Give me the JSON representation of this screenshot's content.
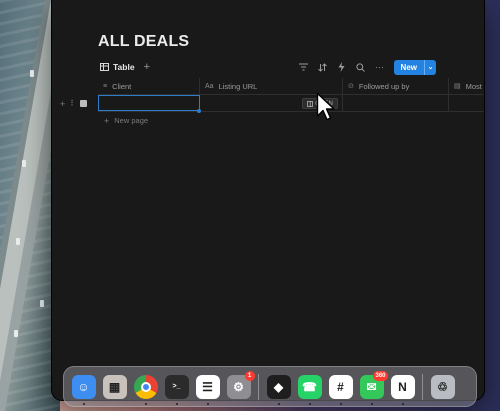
{
  "page": {
    "title": "ALL DEALS"
  },
  "toolbar": {
    "view_tab": "Table",
    "add_view": "+",
    "more": "···",
    "new_label": "New",
    "new_caret": "⌄",
    "accent_color": "#2383e2",
    "tool_icons": [
      "filter-icon",
      "sort-icon",
      "automation-bolt-icon",
      "search-icon",
      "more-icon"
    ]
  },
  "table": {
    "columns": [
      {
        "icon": "≡",
        "label": "Client",
        "icon_name": "text-lines-icon"
      },
      {
        "icon": "Aa",
        "label": "Listing URL",
        "icon_name": "title-aa-icon"
      },
      {
        "icon": "⊙",
        "label": "Followed up by",
        "icon_name": "status-circle-icon"
      },
      {
        "icon": "▤",
        "label": "Most",
        "icon_name": "calendar-icon"
      }
    ],
    "open_button": "OPEN",
    "new_page": "New page",
    "row_add": "+",
    "row_grip": "⠇"
  },
  "dock": {
    "apps": [
      {
        "name": "finder-icon",
        "color": "#3d8ef0",
        "glyph": "☺"
      },
      {
        "name": "launchpad-icon",
        "color": "#c9c2bc",
        "glyph": "▦"
      },
      {
        "name": "chrome-icon",
        "color": "#ffffff",
        "glyph": ""
      },
      {
        "name": "terminal-icon",
        "color": "#2b2b2b",
        "glyph": ">_"
      },
      {
        "name": "reminders-icon",
        "color": "#ffffff",
        "glyph": "☰"
      },
      {
        "name": "system-settings-icon",
        "color": "#8e8e93",
        "glyph": "⚙",
        "badge": "1"
      },
      {
        "name": "cursor-app-icon",
        "color": "#1e1e1e",
        "glyph": "◆"
      },
      {
        "name": "whatsapp-icon",
        "color": "#25d366",
        "glyph": "☎"
      },
      {
        "name": "slack-icon",
        "color": "#ffffff",
        "glyph": "#"
      },
      {
        "name": "messages-icon",
        "color": "#34c759",
        "glyph": "✉",
        "badge": "360"
      },
      {
        "name": "notion-icon",
        "color": "#ffffff",
        "glyph": "N"
      },
      {
        "name": "trash-icon",
        "color": "#b9bcc2",
        "glyph": "♲"
      }
    ]
  }
}
